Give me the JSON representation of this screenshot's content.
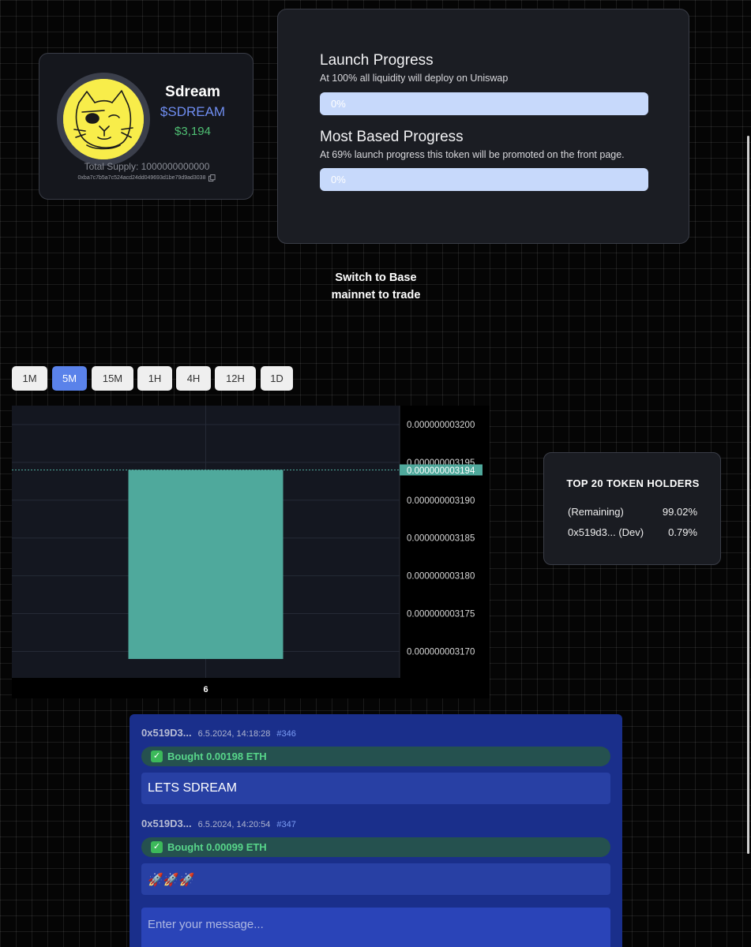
{
  "token": {
    "name": "Sdream",
    "ticker": "$SDREAM",
    "market_cap": "$3,194",
    "total_supply": "Total Supply: 1000000000000",
    "contract": "0xba7c7b5a7c524acd24dd049693d1be79d9ad3038"
  },
  "progress": {
    "launch": {
      "title": "Launch Progress",
      "description": "At 100% all liquidity will deploy on Uniswap",
      "label": "0%",
      "value": 0
    },
    "based": {
      "title": "Most Based Progress",
      "description": "At 69% launch progress this token will be promoted on the front page.",
      "label": "0%",
      "value": 0
    }
  },
  "switch_notice": "Switch to Base mainnet to trade",
  "timeframes": [
    {
      "label": "1M",
      "active": false
    },
    {
      "label": "5M",
      "active": true
    },
    {
      "label": "15M",
      "active": false
    },
    {
      "label": "1H",
      "active": false
    },
    {
      "label": "4H",
      "active": false
    },
    {
      "label": "12H",
      "active": false
    },
    {
      "label": "1D",
      "active": false
    }
  ],
  "chart_data": {
    "type": "bar",
    "categories": [
      "6"
    ],
    "candle": {
      "open": 3.194e-09,
      "close": 3.169e-09,
      "high": 3.194e-09,
      "low": 3.169e-09
    },
    "last_price_label": "0.000000003194",
    "last_price": 3.194e-09,
    "y_ticks": [
      "0.000000003200",
      "0.000000003195",
      "0.000000003190",
      "0.000000003185",
      "0.000000003180",
      "0.000000003175",
      "0.000000003170"
    ],
    "ylim": [
      3.1665e-09,
      3.2025e-09
    ],
    "colors": {
      "candle": "#4fa99c",
      "background": "#141720",
      "grid": "#252a36",
      "price_line": "#4fa99c"
    }
  },
  "holders": {
    "title": "TOP 20 TOKEN HOLDERS",
    "rows": [
      {
        "name": "(Remaining)",
        "pct": "99.02%"
      },
      {
        "name": "0x519d3... (Dev)",
        "pct": "0.79%"
      }
    ]
  },
  "chat": {
    "messages": [
      {
        "author": "0x519D3...",
        "time": "6.5.2024, 14:18:28",
        "id": "#346",
        "bought": "Bought 0.00198 ETH",
        "text": "LETS SDREAM"
      },
      {
        "author": "0x519D3...",
        "time": "6.5.2024, 14:20:54",
        "id": "#347",
        "bought": "Bought 0.00099 ETH",
        "text": "🚀🚀🚀"
      }
    ],
    "input_placeholder": "Enter your message..."
  },
  "colors": {
    "accent": "#5a82ea",
    "positive": "#4fbf73",
    "chat_bg": "#1a2f8b"
  }
}
